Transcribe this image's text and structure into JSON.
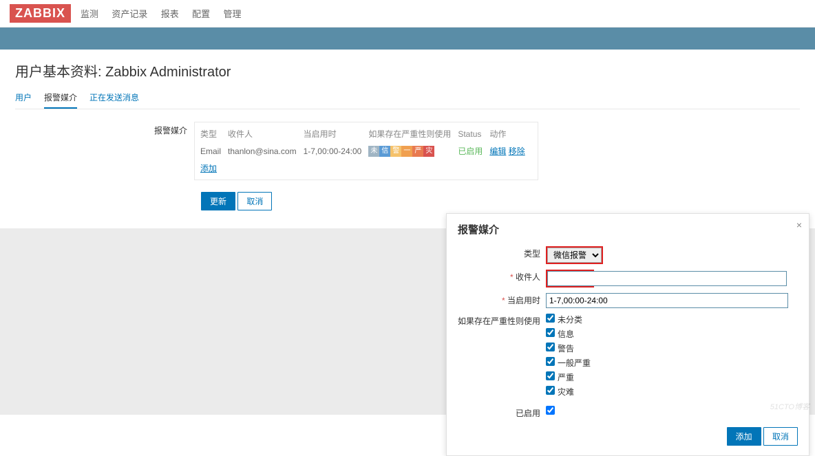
{
  "logo": "ZABBIX",
  "topnav": [
    "监测",
    "资产记录",
    "报表",
    "配置",
    "管理"
  ],
  "page_title": "用户基本资料: Zabbix Administrator",
  "tabs": {
    "user": "用户",
    "media": "报警媒介",
    "sending": "正在发送消息"
  },
  "media_section_label": "报警媒介",
  "media_headers": {
    "type": "类型",
    "recipient": "收件人",
    "active": "当启用时",
    "severity": "如果存在严重性则使用",
    "status": "Status",
    "actions": "动作"
  },
  "media_row": {
    "type": "Email",
    "recipient": "thanlon@sina.com",
    "active": "1-7,00:00-24:00",
    "status": "已启用",
    "edit": "编辑",
    "remove": "移除"
  },
  "severity_pills": [
    {
      "t": "未",
      "c": "#a0b5c4"
    },
    {
      "t": "信",
      "c": "#5b9bd5"
    },
    {
      "t": "警",
      "c": "#f5c26b"
    },
    {
      "t": "一",
      "c": "#f0a050"
    },
    {
      "t": "严",
      "c": "#e87a50"
    },
    {
      "t": "灾",
      "c": "#d9534f"
    }
  ],
  "add_link": "添加",
  "btn_update": "更新",
  "btn_cancel": "取消",
  "dialog": {
    "title": "报警媒介",
    "type_label": "类型",
    "type_value": "微信报警",
    "recipient_label": "收件人",
    "recipient_value": "",
    "active_label": "当启用时",
    "active_value": "1-7,00:00-24:00",
    "severity_label": "如果存在严重性则使用",
    "severities": [
      "未分类",
      "信息",
      "警告",
      "一般严重",
      "严重",
      "灾难"
    ],
    "enabled_label": "已启用",
    "btn_add": "添加",
    "btn_cancel": "取消"
  },
  "watermark": "51CTO博客"
}
